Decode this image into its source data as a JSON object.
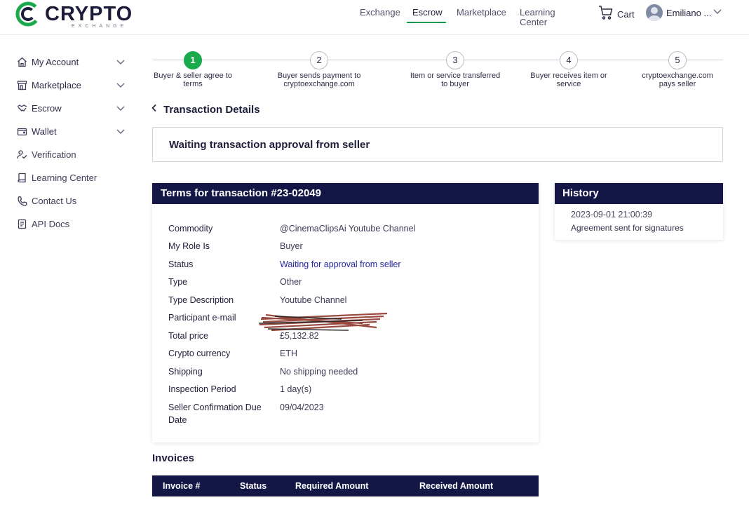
{
  "header": {
    "logo_text": "CRYPTO",
    "logo_subtext": "EXCHANGE",
    "nav": [
      "Exchange",
      "Escrow",
      "Marketplace",
      "Learning Center"
    ],
    "active_nav": "Escrow",
    "cart_label": "Cart",
    "user_name": "Emiliano ..."
  },
  "sidebar": {
    "items": [
      {
        "label": "My Account",
        "icon": "home-icon",
        "expandable": true
      },
      {
        "label": "Marketplace",
        "icon": "store-icon",
        "expandable": true
      },
      {
        "label": "Escrow",
        "icon": "handshake-icon",
        "expandable": true
      },
      {
        "label": "Wallet",
        "icon": "wallet-icon",
        "expandable": true
      },
      {
        "label": "Verification",
        "icon": "user-check-icon",
        "expandable": false
      },
      {
        "label": "Learning Center",
        "icon": "book-icon",
        "expandable": false
      },
      {
        "label": "Contact Us",
        "icon": "phone-icon",
        "expandable": false
      },
      {
        "label": "API Docs",
        "icon": "document-icon",
        "expandable": false
      }
    ]
  },
  "stepper": {
    "steps": [
      {
        "number": "1",
        "label_line1": "Buyer & seller agree to",
        "label_line2": "terms"
      },
      {
        "number": "2",
        "label_line1": "Buyer sends payment to",
        "label_line2": "cryptoexchange.com"
      },
      {
        "number": "3",
        "label_line1": "Item or service transferred",
        "label_line2": "to buyer"
      },
      {
        "number": "4",
        "label_line1": "Buyer receives item or",
        "label_line2": "service"
      },
      {
        "number": "5",
        "label_line1": "cryptoexchange.com",
        "label_line2": "pays seller"
      }
    ],
    "current_step": 1
  },
  "details": {
    "title": "Transaction Details",
    "status_message": "Waiting transaction approval from seller"
  },
  "terms": {
    "title": "Terms for transaction #23-02049",
    "rows": [
      {
        "key": "Commodity",
        "value": "@CinemaClipsAi Youtube Channel"
      },
      {
        "key": "My Role Is",
        "value": "Buyer"
      },
      {
        "key": "Status",
        "value": "Waiting for approval from seller"
      },
      {
        "key": "Type",
        "value": "Other"
      },
      {
        "key": "Type Description",
        "value": "Youtube Channel"
      },
      {
        "key": "Participant e-mail",
        "value": ""
      },
      {
        "key": "Total price",
        "value": "£5,132.82"
      },
      {
        "key": "Crypto currency",
        "value": "ETH"
      },
      {
        "key": "Shipping",
        "value": "No shipping needed"
      },
      {
        "key": "Inspection Period",
        "value": "1 day(s)"
      },
      {
        "key": "Seller Confirmation Due",
        "key_line2": "Date",
        "value": "09/04/2023"
      }
    ]
  },
  "history": {
    "title": "History",
    "entries": [
      {
        "timestamp": "2023-09-01 21:00:39",
        "text": "Agreement sent for signatures"
      }
    ]
  },
  "invoices": {
    "title": "Invoices",
    "columns": [
      "Invoice #",
      "Status",
      "Required Amount",
      "Received Amount"
    ]
  },
  "colors": {
    "navy": "#141646",
    "green": "#1aaa4b",
    "link_blue": "#2525a4"
  }
}
